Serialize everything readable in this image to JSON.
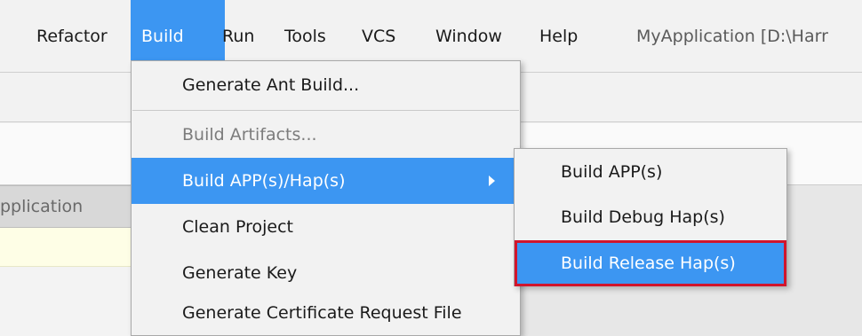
{
  "menubar": {
    "items": [
      {
        "label": "Refactor"
      },
      {
        "label": "Build"
      },
      {
        "label": "Run"
      },
      {
        "label": "Tools"
      },
      {
        "label": "VCS"
      },
      {
        "label": "Window"
      },
      {
        "label": "Help"
      }
    ],
    "window_title": "MyApplication [D:\\Harr"
  },
  "editor_tab": {
    "label": "pplication"
  },
  "build_menu": {
    "items": [
      {
        "label": "Generate Ant Build..."
      },
      {
        "label": "Build Artifacts..."
      },
      {
        "label": "Build APP(s)/Hap(s)"
      },
      {
        "label": "Clean Project"
      },
      {
        "label": "Generate Key"
      },
      {
        "label": "Generate Certificate Request File"
      }
    ]
  },
  "build_submenu": {
    "items": [
      {
        "label": "Build APP(s)"
      },
      {
        "label": "Build Debug Hap(s)"
      },
      {
        "label": "Build Release Hap(s)"
      }
    ]
  },
  "colors": {
    "selection": "#3c96f2",
    "highlight_outline": "#d1152c"
  }
}
